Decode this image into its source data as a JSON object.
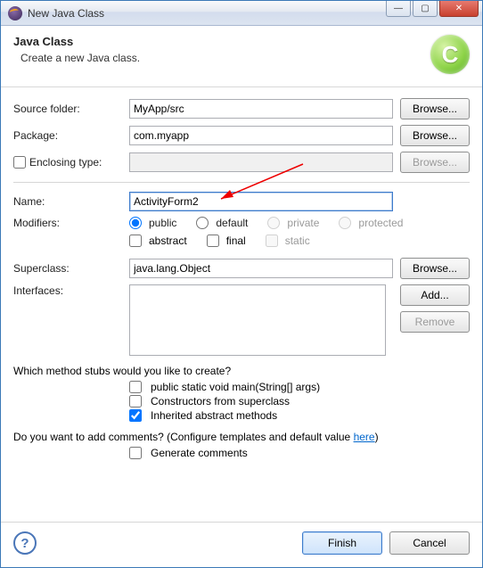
{
  "window": {
    "title": "New Java Class"
  },
  "banner": {
    "title": "Java Class",
    "desc": "Create a new Java class.",
    "icon_letter": "C"
  },
  "labels": {
    "source_folder": "Source folder:",
    "package": "Package:",
    "enclosing_type": "Enclosing type:",
    "name": "Name:",
    "modifiers": "Modifiers:",
    "superclass": "Superclass:",
    "interfaces": "Interfaces:"
  },
  "values": {
    "source_folder": "MyApp/src",
    "package": "com.myapp",
    "enclosing_type": "",
    "name": "ActivityForm2",
    "superclass": "java.lang.Object"
  },
  "buttons": {
    "browse": "Browse...",
    "add": "Add...",
    "remove": "Remove",
    "finish": "Finish",
    "cancel": "Cancel"
  },
  "modifiers": {
    "public": "public",
    "default": "default",
    "private": "private",
    "protected": "protected",
    "abstract": "abstract",
    "final": "final",
    "static": "static"
  },
  "stubs": {
    "question": "Which method stubs would you like to create?",
    "main": "public static void main(String[] args)",
    "constructors": "Constructors from superclass",
    "inherited": "Inherited abstract methods"
  },
  "comments": {
    "question_pre": "Do you want to add comments? (Configure templates and default value ",
    "link": "here",
    "question_post": ")",
    "generate": "Generate comments"
  }
}
